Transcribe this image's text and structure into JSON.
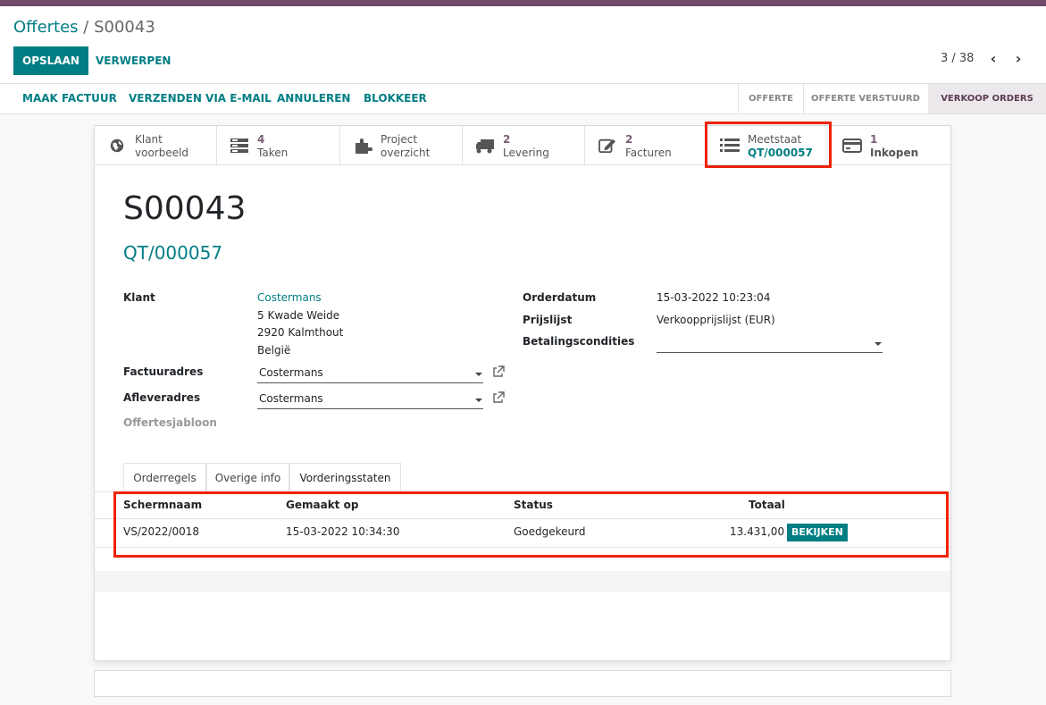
{
  "breadcrumb": {
    "parent": "Offertes",
    "separator": " / ",
    "current": "S00043"
  },
  "actions": {
    "save": "OPSLAAN",
    "discard": "VERWERPEN"
  },
  "pager": {
    "value": "3 / 38",
    "prev_icon": "chevron-left-icon",
    "next_icon": "chevron-right-icon"
  },
  "statusbar": {
    "buttons": [
      "MAAK FACTUUR",
      "VERZENDEN VIA E-MAIL",
      "ANNULEREN",
      "BLOKKEER"
    ],
    "stages": [
      "OFFERTE",
      "OFFERTE VERSTUURD",
      "VERKOOP ORDERS"
    ],
    "active_stage": "VERKOOP ORDERS"
  },
  "smart_buttons": [
    {
      "icon": "globe-icon",
      "line1": "Klant",
      "line2": "voorbeeld"
    },
    {
      "icon": "tasks-icon",
      "count": "4",
      "label": "Taken"
    },
    {
      "icon": "puzzle-icon",
      "line1": "Project",
      "line2": "overzicht"
    },
    {
      "icon": "truck-icon",
      "count": "2",
      "label": "Levering"
    },
    {
      "icon": "edit-icon",
      "count": "2",
      "label": "Facturen"
    },
    {
      "icon": "list-icon",
      "title": "Meetstaat",
      "value": "QT/000057"
    },
    {
      "icon": "credit-card-icon",
      "count": "1",
      "label": "Inkopen"
    }
  ],
  "record": {
    "name": "S00043",
    "reference": "QT/000057"
  },
  "fields": {
    "klant_label": "Klant",
    "klant_name": "Costermans",
    "klant_street": "5 Kwade Weide",
    "klant_city": "2920 Kalmthout",
    "klant_country": "België",
    "factuuradres_label": "Factuuradres",
    "factuuradres_value": "Costermans",
    "afleveradres_label": "Afleveradres",
    "afleveradres_value": "Costermans",
    "offertesjabloon_label": "Offertesjabloon",
    "orderdatum_label": "Orderdatum",
    "orderdatum_value": "15-03-2022 10:23:04",
    "prijslijst_label": "Prijslijst",
    "prijslijst_value": "Verkoopprijslijst (EUR)",
    "betaling_label": "Betalingscondities",
    "betaling_value": ""
  },
  "tabs": [
    "Orderregels",
    "Overige info",
    "Vorderingsstaten"
  ],
  "active_tab": "Vorderingsstaten",
  "table": {
    "columns": [
      "Schermnaam",
      "Gemaakt op",
      "Status",
      "Totaal"
    ],
    "rows": [
      {
        "name": "VS/2022/0018",
        "created": "15-03-2022 10:34:30",
        "status": "Goedgekeurd",
        "total": "13.431,00",
        "action": "BEKIJKEN"
      }
    ]
  },
  "colors": {
    "accent": "#017e84",
    "brand": "#714b67",
    "highlight": "#ee2200"
  }
}
